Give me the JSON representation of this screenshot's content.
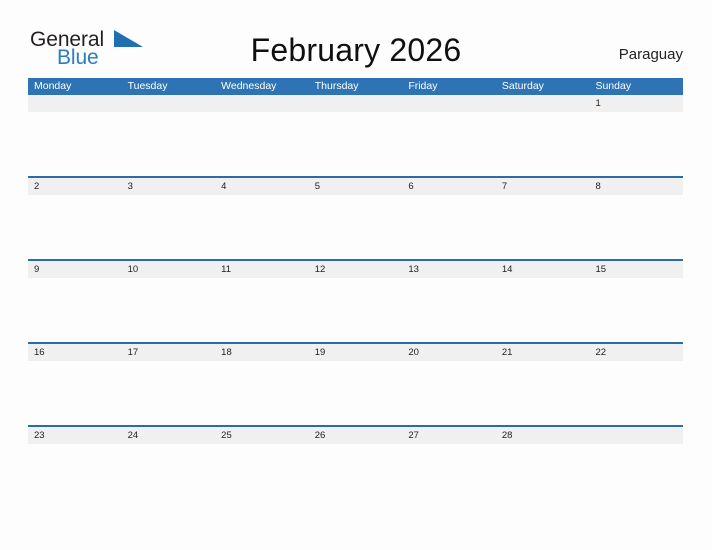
{
  "header": {
    "logo": {
      "word_one": "General",
      "word_two": "Blue",
      "flag_icon": "blue-triangle-flag-icon",
      "dark_color": "#231F20",
      "blue_color": "#2C7CC0"
    },
    "title": "February 2026",
    "country": "Paraguay"
  },
  "calendar": {
    "accent_color": "#2E74B5",
    "separator_color": "#2A6BA8",
    "date_band_color": "#F0F0F0",
    "weekdays": [
      "Monday",
      "Tuesday",
      "Wednesday",
      "Thursday",
      "Friday",
      "Saturday",
      "Sunday"
    ],
    "weeks": [
      {
        "days": [
          "",
          "",
          "",
          "",
          "",
          "",
          "1"
        ]
      },
      {
        "days": [
          "2",
          "3",
          "4",
          "5",
          "6",
          "7",
          "8"
        ]
      },
      {
        "days": [
          "9",
          "10",
          "11",
          "12",
          "13",
          "14",
          "15"
        ]
      },
      {
        "days": [
          "16",
          "17",
          "18",
          "19",
          "20",
          "21",
          "22"
        ]
      },
      {
        "days": [
          "23",
          "24",
          "25",
          "26",
          "27",
          "28",
          ""
        ]
      }
    ]
  }
}
